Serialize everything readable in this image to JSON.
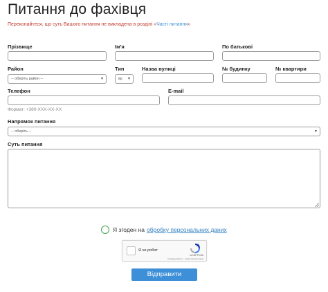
{
  "page": {
    "title": "Питання до фахівця",
    "notice_text": "Переконайтеся, що суть Вашого питання не викладена в розділі «",
    "notice_link": "Часті питання",
    "notice_end": "»"
  },
  "form": {
    "surname_label": "Прізвище",
    "name_label": "Ім'я",
    "patronymic_label": "По батькові",
    "district_label": "Район",
    "district_placeholder": "-- оберіть район --",
    "type_label": "Тип",
    "type_value": "ву.",
    "street_label": "Назва вулиці",
    "house_label": "№ будинку",
    "apartment_label": "№ квартири",
    "phone_label": "Телефон",
    "phone_hint": "Формат: +380-XXX-XX-XX",
    "email_label": "E-mail",
    "direction_label": "Напрямок питання",
    "direction_placeholder": "-- оберіть --",
    "question_label": "Суть питання"
  },
  "consent": {
    "text": "Я згоден на",
    "link": "обробку персональних даних"
  },
  "captcha": {
    "label": "Я не робот",
    "brand": "reCAPTCHA",
    "terms": "Конфіденційність - Умови використання"
  },
  "submit_label": "Відправити",
  "colors": {
    "accent": "#3d8fd8",
    "notice": "#c0392b",
    "consent_radio": "#3fa34d"
  }
}
